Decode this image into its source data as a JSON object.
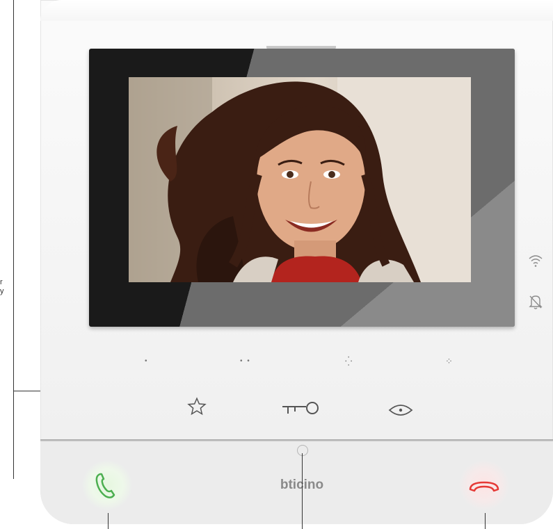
{
  "edge_text": {
    "line1": "r",
    "line2": "y"
  },
  "brand": {
    "name": "bticino"
  },
  "indicators": [
    {
      "icon": "wifi-icon"
    },
    {
      "icon": "bell-off-icon"
    }
  ],
  "keys": [
    {
      "dots": "•",
      "icon": "star-icon"
    },
    {
      "dots": "• •",
      "icon": "key-icon"
    },
    {
      "dots": "⁛",
      "icon": "eye-icon"
    },
    {
      "dots": "⁘",
      "icon": null
    }
  ],
  "call_buttons": [
    {
      "icon": "answer-call-icon",
      "color": "#4caf50"
    },
    {
      "icon": "end-call-icon",
      "color": "#e53935"
    }
  ],
  "colors": {
    "device_body": "#f3f3f3",
    "bezel": "#1a1a1a",
    "answer_green": "#4caf50",
    "hangup_red": "#e53935"
  }
}
